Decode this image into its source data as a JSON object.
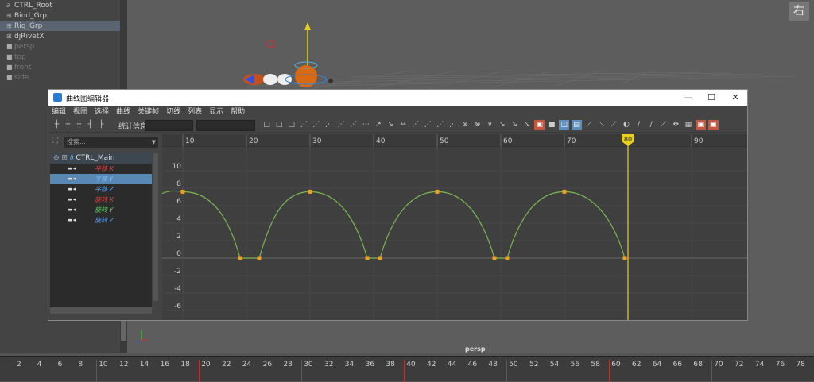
{
  "outliner": {
    "items": [
      {
        "label": "CTRL_Root",
        "icon": "curve-icon",
        "selected": false
      },
      {
        "label": "Bind_Grp",
        "icon": "group-icon",
        "selected": false
      },
      {
        "label": "Rig_Grp",
        "icon": "group-icon",
        "selected": true
      },
      {
        "label": "djRivetX",
        "icon": "group-icon",
        "selected": false
      },
      {
        "label": "persp",
        "icon": "camera-icon",
        "selected": false
      },
      {
        "label": "top",
        "icon": "camera-icon",
        "selected": false
      },
      {
        "label": "front",
        "icon": "camera-icon",
        "selected": false
      },
      {
        "label": "side",
        "icon": "camera-icon",
        "selected": false
      }
    ]
  },
  "viewport": {
    "camera_label": "persp",
    "view_cube_label": "右"
  },
  "graph_editor": {
    "title": "曲线图编辑器",
    "menus": [
      "编辑",
      "视图",
      "选择",
      "曲线",
      "关键帧",
      "切线",
      "列表",
      "显示",
      "帮助"
    ],
    "stats_label": "统计信息",
    "search_placeholder": "搜索...",
    "node_name": "CTRL_Main",
    "channels": [
      {
        "label": "平移 X",
        "color": "#e04040",
        "selected": false
      },
      {
        "label": "平移 Y",
        "color": "#7ec0ff",
        "selected": true
      },
      {
        "label": "平移 Z",
        "color": "#5aa0ff",
        "selected": false
      },
      {
        "label": "旋转 X",
        "color": "#e04040",
        "selected": false
      },
      {
        "label": "旋转 Y",
        "color": "#60d060",
        "selected": false
      },
      {
        "label": "旋转 Z",
        "color": "#5aa0ff",
        "selected": false
      }
    ],
    "ruler_ticks": [
      "10",
      "20",
      "30",
      "40",
      "50",
      "60",
      "70",
      "80",
      "90"
    ],
    "current_frame": "80",
    "y_ticks": [
      "10",
      "8",
      "6",
      "4",
      "2",
      "0",
      "-2",
      "-4",
      "-6"
    ],
    "curve_color": "#7ab850",
    "key_color": "#f0a020",
    "time_cursor_color": "#e8d020"
  },
  "timeline": {
    "ticks": [
      "2",
      "4",
      "6",
      "8",
      "10",
      "12",
      "14",
      "16",
      "18",
      "20",
      "22",
      "24",
      "26",
      "28",
      "30",
      "32",
      "34",
      "36",
      "38",
      "40",
      "42",
      "44",
      "46",
      "48",
      "50",
      "52",
      "54",
      "56",
      "58",
      "60",
      "62",
      "64",
      "66",
      "68",
      "70",
      "72",
      "74",
      "76",
      "78"
    ]
  },
  "window_controls": {
    "minimize": "—",
    "maximize": "☐",
    "close": "✕"
  }
}
